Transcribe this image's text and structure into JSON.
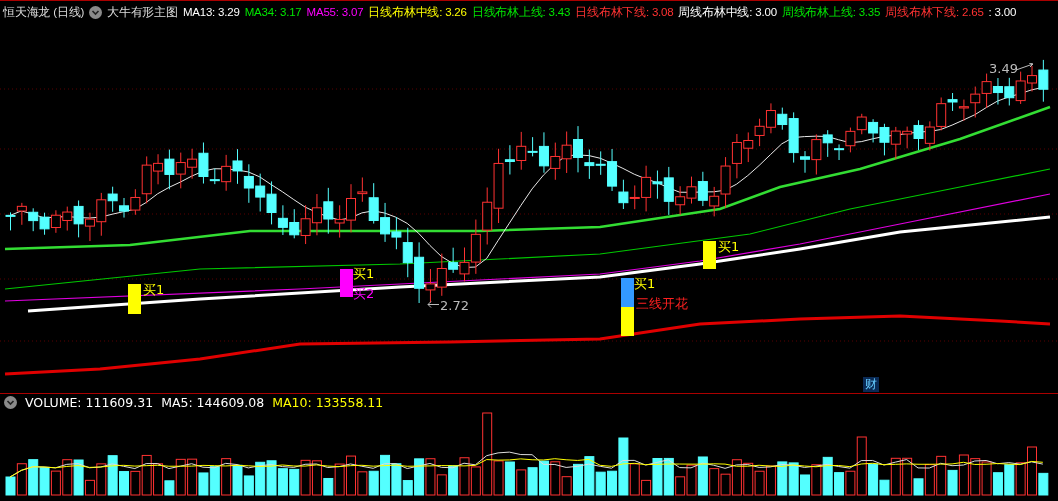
{
  "header": {
    "title": "恒天海龙 (日线)",
    "indicator": "大牛有形主图",
    "values": [
      {
        "text": "MA13: 3.29",
        "color": "#ffffff"
      },
      {
        "text": "MA34: 3.17",
        "color": "#00e600"
      },
      {
        "text": "MA55: 3.07",
        "color": "#ff00ff"
      },
      {
        "text": "日线布林中线: 3.26",
        "color": "#ffff00"
      },
      {
        "text": "日线布林上线: 3.43",
        "color": "#00e600"
      },
      {
        "text": "日线布林下线: 3.08",
        "color": "#ff3232"
      },
      {
        "text": "周线布林中线: 3.00",
        "color": "#ffffff"
      },
      {
        "text": "周线布林上线: 3.35",
        "color": "#00e600"
      },
      {
        "text": "周线布林下线: 2.65",
        "color": "#ff3232"
      },
      {
        "text": ": 3.00",
        "color": "#ffffff"
      }
    ]
  },
  "chart": {
    "markers": [
      {
        "segments": [
          {
            "color": "#ffff00"
          }
        ],
        "labels": [
          {
            "text": "买1",
            "color": "#ffff00"
          }
        ]
      },
      {
        "segments": [
          {
            "color": "#ff00ff"
          }
        ],
        "labels": [
          {
            "text": "买1",
            "color": "#ffff00"
          },
          {
            "text": "买2",
            "color": "#ff00ff"
          }
        ]
      },
      {
        "segments": [
          {
            "color": "#3399ff"
          },
          {
            "color": "#ffff00"
          }
        ],
        "labels": [
          {
            "text": "买1",
            "color": "#ffff00"
          },
          {
            "text": "三线开花",
            "color": "#ff2020"
          }
        ]
      },
      {
        "segments": [
          {
            "color": "#ffff00"
          }
        ],
        "labels": [
          {
            "text": "买1",
            "color": "#ffff00"
          }
        ]
      }
    ],
    "low_label": "2.72",
    "high_label": "3.49",
    "badge": "财"
  },
  "volume": {
    "values": [
      {
        "text": "VOLUME: 111609.31",
        "color": "#ffffff"
      },
      {
        "text": "MA5: 144609.08",
        "color": "#ffffff"
      },
      {
        "text": "MA10: 133558.11",
        "color": "#ffff00"
      }
    ]
  }
}
